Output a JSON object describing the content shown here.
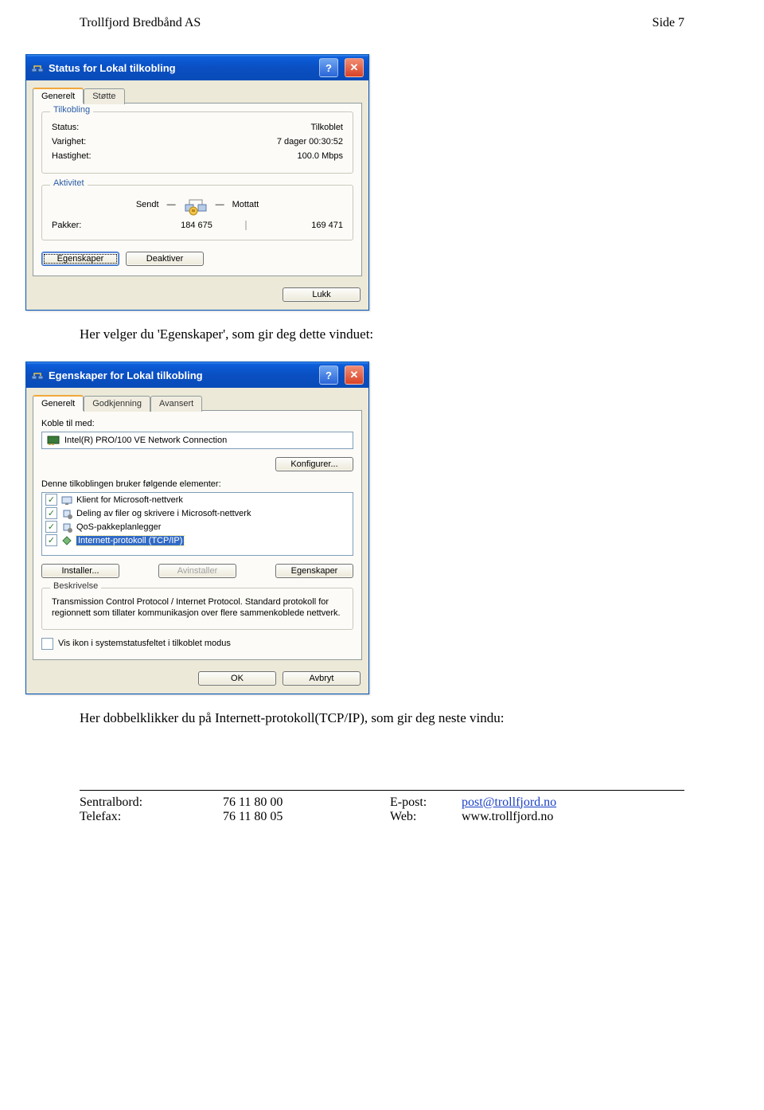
{
  "page_header": {
    "left": "Trollfjord Bredbånd AS",
    "right": "Side 7"
  },
  "dialog1": {
    "title": "Status for Lokal tilkobling",
    "tabs": {
      "active": "Generelt",
      "inactive": "Støtte"
    },
    "group_connection": {
      "legend": "Tilkobling",
      "status_label": "Status:",
      "status_value": "Tilkoblet",
      "duration_label": "Varighet:",
      "duration_value": "7 dager 00:30:52",
      "speed_label": "Hastighet:",
      "speed_value": "100.0 Mbps"
    },
    "group_activity": {
      "legend": "Aktivitet",
      "sent_label": "Sendt",
      "received_label": "Mottatt",
      "packets_label": "Pakker:",
      "packets_sent": "184 675",
      "packets_received": "169 471"
    },
    "buttons": {
      "properties": "Egenskaper",
      "deactivate": "Deaktiver",
      "close": "Lukk"
    }
  },
  "body_text_1": "Her velger du 'Egenskaper', som gir deg dette vinduet:",
  "dialog2": {
    "title": "Egenskaper for Lokal tilkobling",
    "tabs": {
      "t1": "Generelt",
      "t2": "Godkjenning",
      "t3": "Avansert"
    },
    "connect_using_label": "Koble til med:",
    "adapter_name": "Intel(R) PRO/100 VE Network Connection",
    "configure_btn": "Konfigurer...",
    "elements_label": "Denne tilkoblingen bruker følgende elementer:",
    "items": {
      "i1": "Klient for Microsoft-nettverk",
      "i2": "Deling av filer og skrivere i Microsoft-nettverk",
      "i3": "QoS-pakkeplanlegger",
      "i4": "Internett-protokoll (TCP/IP)"
    },
    "buttons": {
      "install": "Installer...",
      "uninstall": "Avinstaller",
      "properties": "Egenskaper",
      "ok": "OK",
      "cancel": "Avbryt"
    },
    "description": {
      "legend": "Beskrivelse",
      "text": "Transmission Control Protocol / Internet Protocol. Standard protokoll for regionnett som tillater kommunikasjon over flere sammenkoblede nettverk."
    },
    "show_icon_label": "Vis ikon i systemstatusfeltet i tilkoblet modus"
  },
  "body_text_2": "Her dobbelklikker du på Internett-protokoll(TCP/IP), som gir deg neste vindu:",
  "footer": {
    "switchboard_label": "Sentralbord:",
    "switchboard_value": "76 11 80 00",
    "fax_label": "Telefax:",
    "fax_value": "76 11 80 05",
    "email_label": "E-post:",
    "email_value": "post@trollfjord.no",
    "web_label": "Web:",
    "web_value": "www.trollfjord.no"
  }
}
